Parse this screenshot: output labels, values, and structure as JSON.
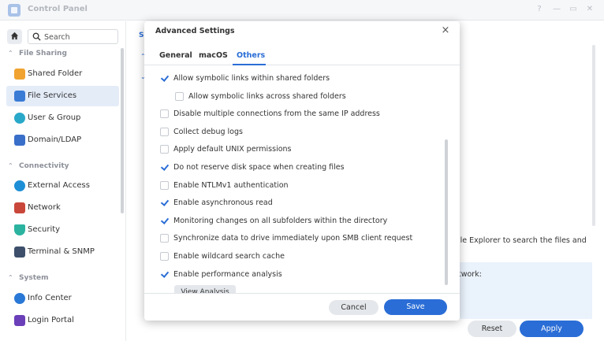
{
  "window": {
    "title": "Control Panel",
    "controls": [
      "?",
      "—",
      "▭",
      "✕"
    ]
  },
  "sidebar": {
    "search_placeholder": "Search",
    "sections": [
      {
        "label": "File Sharing",
        "items": [
          {
            "label": "Shared Folder",
            "icon": "shared-folder-icon",
            "color": "#f0a330"
          },
          {
            "label": "File Services",
            "icon": "file-services-icon",
            "color": "#3a7bd5",
            "active": true
          },
          {
            "label": "User & Group",
            "icon": "user-group-icon",
            "color": "#2aa8c9"
          },
          {
            "label": "Domain/LDAP",
            "icon": "domain-ldap-icon",
            "color": "#3a6fc9"
          }
        ]
      },
      {
        "label": "Connectivity",
        "items": [
          {
            "label": "External Access",
            "icon": "external-access-icon",
            "color": "#1e8fd6"
          },
          {
            "label": "Network",
            "icon": "network-icon",
            "color": "#c9473a"
          },
          {
            "label": "Security",
            "icon": "security-icon",
            "color": "#2bb3a0"
          },
          {
            "label": "Terminal & SNMP",
            "icon": "terminal-icon",
            "color": "#3d4f6b"
          }
        ]
      },
      {
        "label": "System",
        "items": [
          {
            "label": "Info Center",
            "icon": "info-center-icon",
            "color": "#2a78d6"
          },
          {
            "label": "Login Portal",
            "icon": "login-portal-icon",
            "color": "#6a3fb8"
          }
        ]
      }
    ]
  },
  "background": {
    "tab_label": "S",
    "text_line": "ile Explorer to search the files and",
    "info_text": "twork:",
    "reset_label": "Reset",
    "apply_label": "Apply"
  },
  "dialog": {
    "title": "Advanced Settings",
    "tabs": [
      "General",
      "macOS",
      "Others"
    ],
    "active_tab": "Others",
    "options": [
      {
        "label": "Allow symbolic links within shared folders",
        "checked": true,
        "indent": false
      },
      {
        "label": "Allow symbolic links across shared folders",
        "checked": false,
        "indent": true
      },
      {
        "label": "Disable multiple connections from the same IP address",
        "checked": false,
        "indent": false
      },
      {
        "label": "Collect debug logs",
        "checked": false,
        "indent": false
      },
      {
        "label": "Apply default UNIX permissions",
        "checked": false,
        "indent": false
      },
      {
        "label": "Do not reserve disk space when creating files",
        "checked": true,
        "indent": false
      },
      {
        "label": "Enable NTLMv1 authentication",
        "checked": false,
        "indent": false
      },
      {
        "label": "Enable asynchronous read",
        "checked": true,
        "indent": false
      },
      {
        "label": "Monitoring changes on all subfolders within the directory",
        "checked": true,
        "indent": false
      },
      {
        "label": "Synchronize data to drive immediately upon SMB client request",
        "checked": false,
        "indent": false
      },
      {
        "label": "Enable wildcard search cache",
        "checked": false,
        "indent": false
      },
      {
        "label": "Enable performance analysis",
        "checked": true,
        "indent": false
      }
    ],
    "view_analysis_label": "View Analysis",
    "cancel_label": "Cancel",
    "save_label": "Save",
    "accent": "#2a6dd6"
  }
}
